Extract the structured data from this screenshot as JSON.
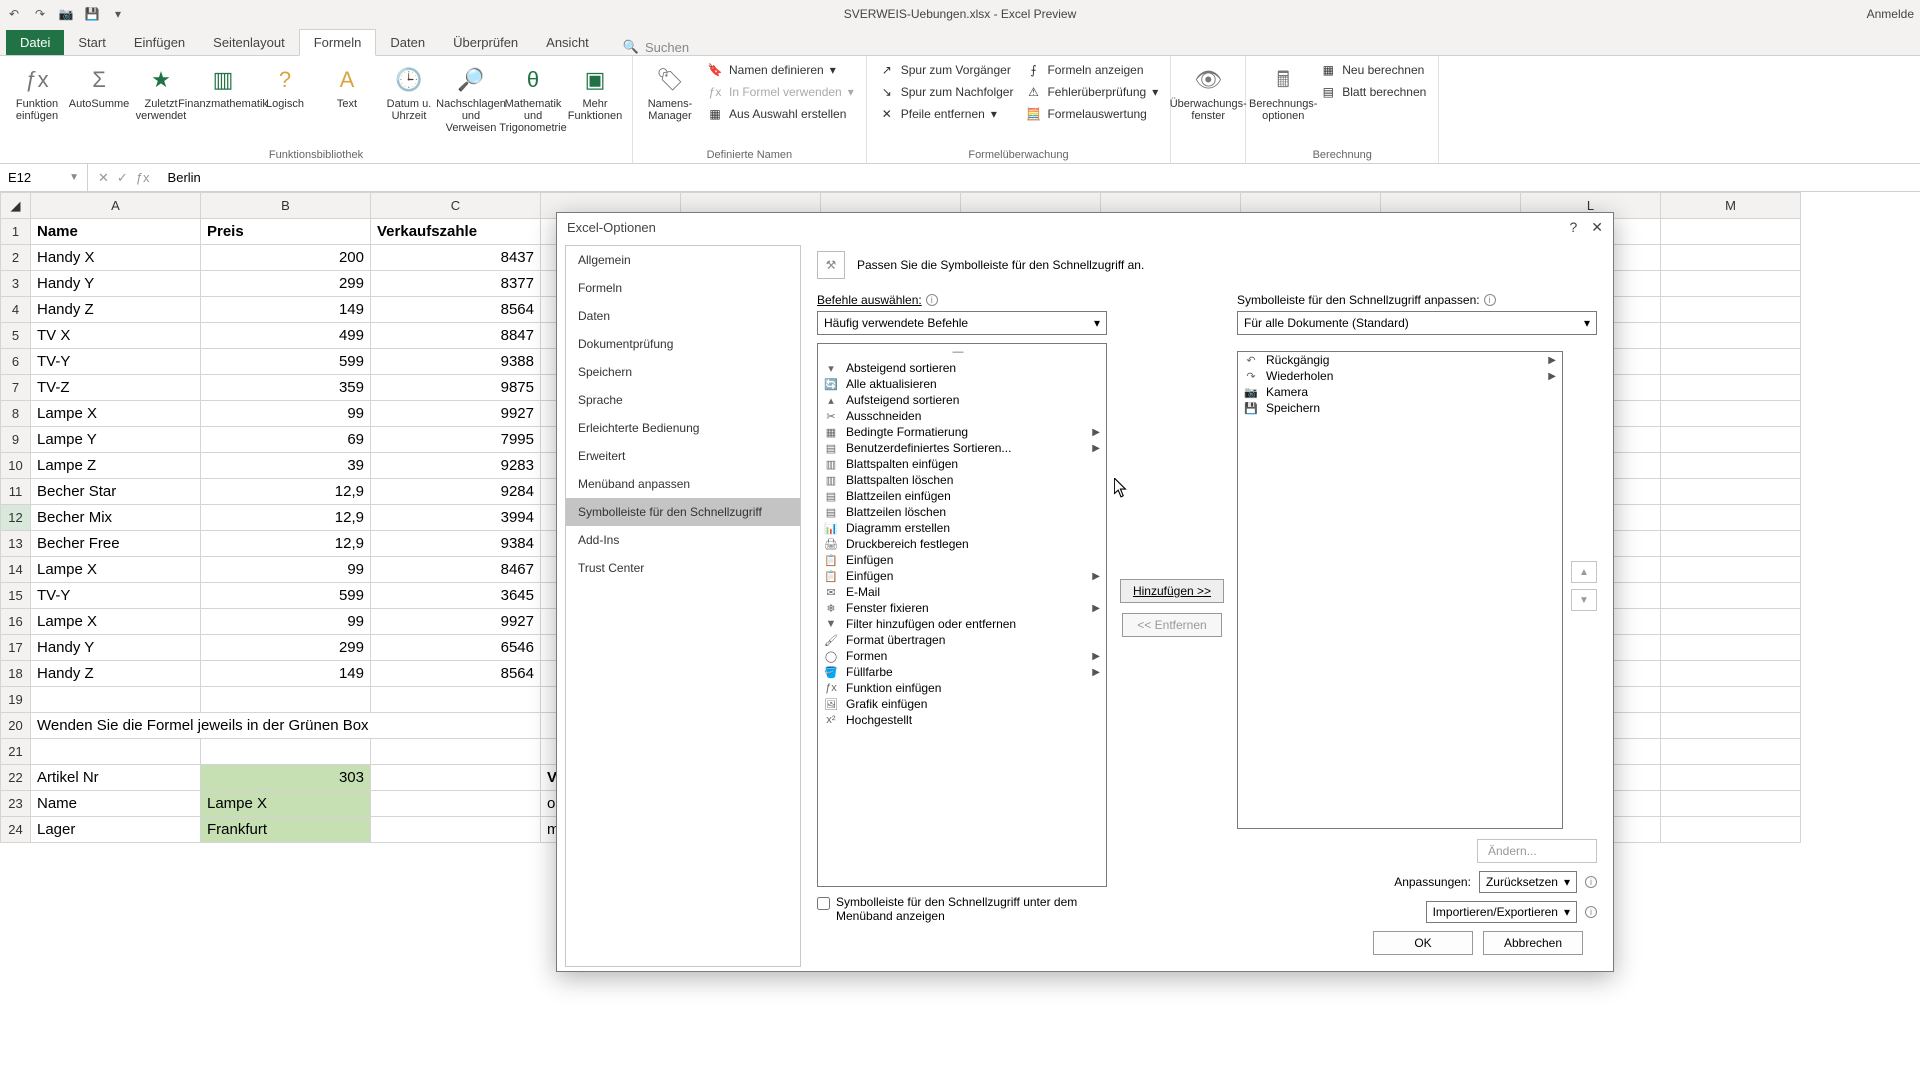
{
  "title": "SVERWEIS-Uebungen.xlsx - Excel Preview",
  "account": "Anmelde",
  "tabs": {
    "file": "Datei",
    "home": "Start",
    "insert": "Einfügen",
    "layout": "Seitenlayout",
    "formulas": "Formeln",
    "data": "Daten",
    "review": "Überprüfen",
    "view": "Ansicht",
    "search": "Suchen"
  },
  "ribbon": {
    "insert_fn": "Funktion einfügen",
    "autosum": "AutoSumme",
    "recent": "Zuletzt verwendet",
    "financial": "Finanzmathematik",
    "logical": "Logisch",
    "text": "Text",
    "datetime": "Datum u. Uhrzeit",
    "lookup": "Nachschlagen und Verweisen",
    "math": "Mathematik und Trigonometrie",
    "more": "Mehr Funktionen",
    "group_lib": "Funktionsbibliothek",
    "name_mgr": "Namens-Manager",
    "name_define": "Namen definieren",
    "name_use": "In Formel verwenden",
    "name_create": "Aus Auswahl erstellen",
    "group_names": "Definierte Namen",
    "trace_prec": "Spur zum Vorgänger",
    "trace_dep": "Spur zum Nachfolger",
    "remove_arrows": "Pfeile entfernen",
    "show_formulas": "Formeln anzeigen",
    "error_check": "Fehlerüberprüfung",
    "eval_formula": "Formelauswertung",
    "group_audit": "Formelüberwachung",
    "watch": "Überwachungs-fenster",
    "calc_opts": "Berechnungs-optionen",
    "calc_now": "Neu berechnen",
    "calc_sheet": "Blatt berechnen",
    "group_calc": "Berechnung"
  },
  "namebox": "E12",
  "formula": "Berlin",
  "cols": [
    "A",
    "B",
    "C",
    "",
    "",
    "",
    "",
    "",
    "",
    "",
    "L",
    "M"
  ],
  "headers": {
    "name": "Name",
    "preis": "Preis",
    "verkauf": "Verkaufszahle"
  },
  "rows": [
    {
      "n": "Handy X",
      "p": "200",
      "v": "8437"
    },
    {
      "n": "Handy Y",
      "p": "299",
      "v": "8377"
    },
    {
      "n": "Handy Z",
      "p": "149",
      "v": "8564"
    },
    {
      "n": "TV X",
      "p": "499",
      "v": "8847"
    },
    {
      "n": "TV-Y",
      "p": "599",
      "v": "9388"
    },
    {
      "n": "TV-Z",
      "p": "359",
      "v": "9875"
    },
    {
      "n": "Lampe X",
      "p": "99",
      "v": "9927"
    },
    {
      "n": "Lampe Y",
      "p": "69",
      "v": "7995"
    },
    {
      "n": "Lampe Z",
      "p": "39",
      "v": "9283"
    },
    {
      "n": "Becher Star",
      "p": "12,9",
      "v": "9284"
    },
    {
      "n": "Becher Mix",
      "p": "12,9",
      "v": "3994"
    },
    {
      "n": "Becher Free",
      "p": "12,9",
      "v": "9384"
    },
    {
      "n": "Lampe X",
      "p": "99",
      "v": "8467"
    },
    {
      "n": "TV-Y",
      "p": "599",
      "v": "3645"
    },
    {
      "n": "Lampe X",
      "p": "99",
      "v": "9927"
    },
    {
      "n": "Handy Y",
      "p": "299",
      "v": "6546"
    },
    {
      "n": "Handy Z",
      "p": "149",
      "v": "8564"
    }
  ],
  "note20": "Wenden Sie die Formel jeweils in der Grünen Box",
  "lower": {
    "artikel": "Artikel Nr",
    "artikel_v": "303",
    "name": "Name",
    "name_v": "Lampe X",
    "lager": "Lager",
    "lager_v": "Frankfurt",
    "vk": "Verkaufszahlen",
    "om": "o. Matrix",
    "mm": "m. Matrix"
  },
  "dlg": {
    "title": "Excel-Optionen",
    "nav": [
      "Allgemein",
      "Formeln",
      "Daten",
      "Dokumentprüfung",
      "Speichern",
      "Sprache",
      "Erleichterte Bedienung",
      "Erweitert",
      "Menüband anpassen",
      "Symbolleiste für den Schnellzugriff",
      "Add-Ins",
      "Trust Center"
    ],
    "nav_active": 9,
    "heading": "Passen Sie die Symbolleiste für den Schnellzugriff an.",
    "left_label": "Befehle auswählen:",
    "left_combo": "Häufig verwendete Befehle",
    "right_label": "Symbolleiste für den Schnellzugriff anpassen:",
    "right_combo": "Für alle Dokumente (Standard)",
    "left_list": [
      "<Trennzeichen>",
      "Absteigend sortieren",
      "Alle aktualisieren",
      "Aufsteigend sortieren",
      "Ausschneiden",
      "Bedingte Formatierung",
      "Benutzerdefiniertes Sortieren...",
      "Blattspalten einfügen",
      "Blattspalten löschen",
      "Blattzeilen einfügen",
      "Blattzeilen löschen",
      "Diagramm erstellen",
      "Druckbereich festlegen",
      "Einfügen",
      "Einfügen",
      "E-Mail",
      "Fenster fixieren",
      "Filter hinzufügen oder entfernen",
      "Format übertragen",
      "Formen",
      "Füllfarbe",
      "Funktion einfügen",
      "Grafik einfügen",
      "Hochgestellt"
    ],
    "left_submenu": [
      5,
      6,
      14,
      16,
      19,
      20
    ],
    "right_list": [
      "Rückgängig",
      "Wiederholen",
      "Kamera",
      "Speichern"
    ],
    "right_submenu": [
      0,
      1
    ],
    "add": "Hinzufügen >>",
    "remove": "<< Entfernen",
    "below_chk": "Symbolleiste für den Schnellzugriff unter dem Menüband anzeigen",
    "modify": "Ändern...",
    "custom_lbl": "Anpassungen:",
    "reset": "Zurücksetzen",
    "impexp": "Importieren/Exportieren",
    "ok": "OK",
    "cancel": "Abbrechen"
  }
}
